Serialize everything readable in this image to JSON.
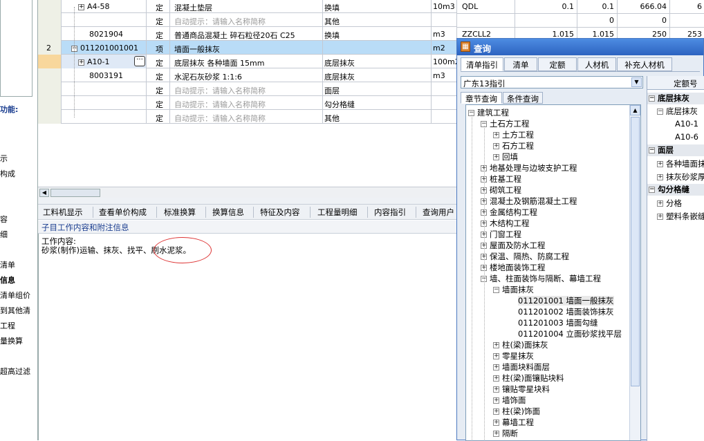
{
  "left_items": [
    "功能:",
    "示",
    "构成",
    "容",
    "细",
    "清单",
    "信息",
    "清单组价",
    "到其他清",
    "工程",
    "量换算",
    "超高过滤"
  ],
  "grid_rows": [
    {
      "code": "A4-58",
      "type": "定",
      "name": "混凝土垫层",
      "spec": "换填",
      "unit": "10m3",
      "c6": "QDL",
      "c7": "0.1",
      "c8": "0.1",
      "c9": "666.04",
      "c10": "6"
    },
    {
      "code": "",
      "type": "定",
      "name": "自动提示：请输入名称简称",
      "spec": "其他",
      "unit": "",
      "c6": "",
      "c7": "",
      "c8": "0",
      "c9": "0",
      "c10": ""
    },
    {
      "code": "8021904",
      "type": "定",
      "name": "普通商品混凝土 碎石粒径20石 C25",
      "spec": "换填",
      "unit": "m3",
      "c6": "ZZCLL2",
      "c7": "1.015",
      "c8": "1.015",
      "c9": "250",
      "c10": "253"
    },
    {
      "no": "2",
      "code": "011201001001",
      "type": "项",
      "name": "墙面一般抹灰",
      "spec": "",
      "unit": "m2",
      "c6": "",
      "c7": "",
      "c8": "",
      "c9": "",
      "c10": ""
    },
    {
      "code": "A10-1",
      "type": "定",
      "name": "底层抹灰 各种墙面 15mm",
      "spec": "底层抹灰",
      "unit": "100m2",
      "c6": "",
      "c7": "",
      "c8": "",
      "c9": "",
      "c10": ""
    },
    {
      "code": "8003191",
      "type": "定",
      "name": "水泥石灰砂浆 1:1:6",
      "spec": "底层抹灰",
      "unit": "m3",
      "c6": "",
      "c7": "",
      "c8": "",
      "c9": "",
      "c10": ""
    },
    {
      "code": "",
      "type": "定",
      "name": "自动提示：请输入名称简称",
      "spec": "面层",
      "unit": "",
      "c6": "",
      "c7": "",
      "c8": "",
      "c9": "",
      "c10": ""
    },
    {
      "code": "",
      "type": "定",
      "name": "自动提示：请输入名称简称",
      "spec": "勾分格缝",
      "unit": "",
      "c6": "",
      "c7": "",
      "c8": "",
      "c9": "",
      "c10": ""
    },
    {
      "code": "",
      "type": "定",
      "name": "自动提示：请输入名称简称",
      "spec": "其他",
      "unit": "",
      "c6": "",
      "c7": "",
      "c8": "",
      "c9": "",
      "c10": ""
    }
  ],
  "bottom_tabs": [
    "工料机显示",
    "查看单价构成",
    "标准换算",
    "换算信息",
    "特征及内容",
    "工程量明细",
    "内容指引",
    "查询用户"
  ],
  "info": {
    "header": "子目工作内容和附注信息",
    "line1": "工作内容:",
    "line2": "砂浆(制作)运输、抹灰、找平、刷水泥浆。"
  },
  "dialog": {
    "title": "查询",
    "tabs": [
      "清单指引",
      "清单",
      "定额",
      "人材机",
      "补充人材机"
    ],
    "dropdown": "广东13指引",
    "subtabs": [
      "章节查询",
      "条件查询"
    ],
    "tree": [
      "建筑工程",
      "土石方工程",
      "土方工程",
      "石方工程",
      "回填",
      "地基处理与边坡支护工程",
      "桩基工程",
      "砌筑工程",
      "混凝土及钢筋混凝土工程",
      "金属结构工程",
      "木结构工程",
      "门窗工程",
      "屋面及防水工程",
      "保温、隔热、防腐工程",
      "楼地面装饰工程",
      "墙、柱面装饰与隔断、幕墙工程",
      "墙面抹灰",
      "011201001  墙面一般抹灰",
      "011201002  墙面装饰抹灰",
      "011201003  墙面勾缝",
      "011201004  立面砂浆找平层",
      "柱(梁)面抹灰",
      "零星抹灰",
      "墙面块料面层",
      "柱(梁)面镶贴块料",
      "镶贴零星块料",
      "墙饰面",
      "柱(梁)饰面",
      "幕墙工程",
      "隔断"
    ],
    "right": {
      "header": "定额号",
      "items": [
        "底层抹灰",
        "底层抹灰",
        "A10-1",
        "A10-6",
        "面层",
        "各种墙面抹",
        "抹灰砂浆厚",
        "勾分格缝",
        "分格",
        "塑料条嵌缝"
      ]
    }
  }
}
